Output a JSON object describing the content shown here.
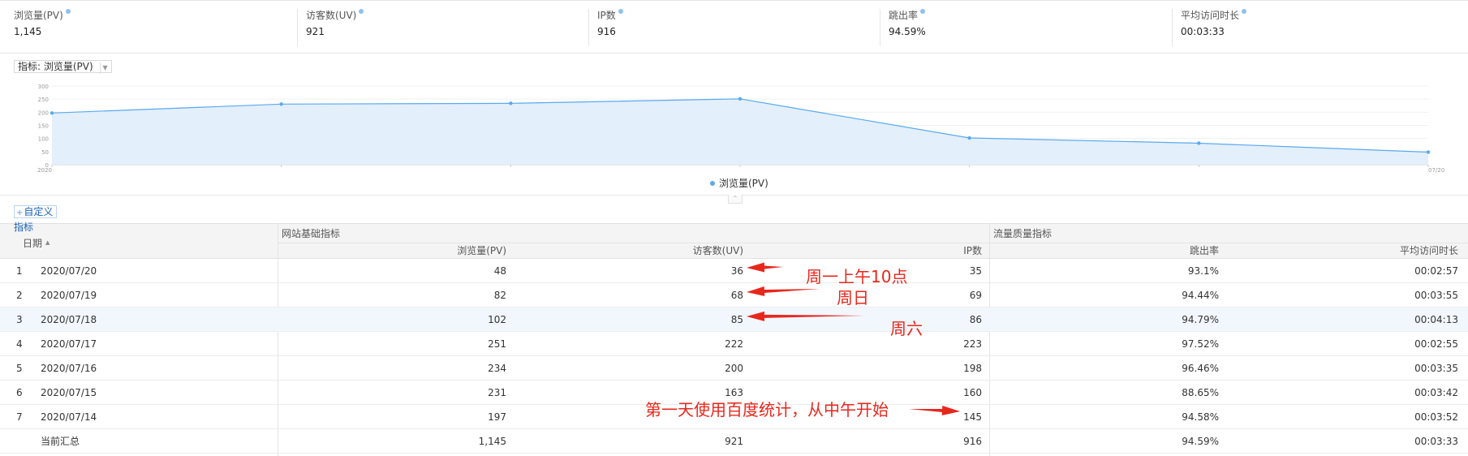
{
  "summary": [
    {
      "label": "浏览量(PV)",
      "value": "1,145"
    },
    {
      "label": "访客数(UV)",
      "value": "921"
    },
    {
      "label": "IP数",
      "value": "916"
    },
    {
      "label": "跳出率",
      "value": "94.59%"
    },
    {
      "label": "平均访问时长",
      "value": "00:03:33"
    }
  ],
  "indicator_select": {
    "prefix": "指标:",
    "value": "浏览量(PV)"
  },
  "customize_label": "自定义",
  "chart_data": {
    "type": "area",
    "x": [
      "2020/07/14",
      "2020/07/15",
      "2020/07/16",
      "2020/07/17",
      "2020/07/18",
      "2020/07/19",
      "2020/07/20"
    ],
    "x_tick_labels": [
      "2020",
      "",
      "",
      "",
      "",
      "",
      "07/20"
    ],
    "series": [
      {
        "name": "浏览量(PV)",
        "values": [
          197,
          231,
          234,
          251,
          102,
          82,
          48
        ],
        "color": "#5aa9ef"
      }
    ],
    "ylim": [
      0,
      300
    ],
    "yticks": [
      0,
      50,
      100,
      150,
      200,
      250,
      300
    ],
    "fill_color": "#e3effb",
    "grid": true,
    "legend": "bottom-center"
  },
  "table": {
    "corner_top": "指标",
    "corner_bottom": "日期",
    "group_basic": "网站基础指标",
    "group_quality": "流量质量指标",
    "columns": [
      "浏览量(PV)",
      "访客数(UV)",
      "IP数",
      "跳出率",
      "平均访问时长"
    ],
    "rows": [
      {
        "idx": "1",
        "date": "2020/07/20",
        "pv": "48",
        "uv": "36",
        "ip": "35",
        "bounce": "93.1%",
        "dur": "00:02:57"
      },
      {
        "idx": "2",
        "date": "2020/07/19",
        "pv": "82",
        "uv": "68",
        "ip": "69",
        "bounce": "94.44%",
        "dur": "00:03:55"
      },
      {
        "idx": "3",
        "date": "2020/07/18",
        "pv": "102",
        "uv": "85",
        "ip": "86",
        "bounce": "94.79%",
        "dur": "00:04:13"
      },
      {
        "idx": "4",
        "date": "2020/07/17",
        "pv": "251",
        "uv": "222",
        "ip": "223",
        "bounce": "97.52%",
        "dur": "00:02:55"
      },
      {
        "idx": "5",
        "date": "2020/07/16",
        "pv": "234",
        "uv": "200",
        "ip": "198",
        "bounce": "96.46%",
        "dur": "00:03:35"
      },
      {
        "idx": "6",
        "date": "2020/07/15",
        "pv": "231",
        "uv": "163",
        "ip": "160",
        "bounce": "88.65%",
        "dur": "00:03:42"
      },
      {
        "idx": "7",
        "date": "2020/07/14",
        "pv": "197",
        "uv": "",
        "ip": "145",
        "bounce": "94.58%",
        "dur": "00:03:52"
      }
    ],
    "total": {
      "label": "当前汇总",
      "pv": "1,145",
      "uv": "921",
      "ip": "916",
      "bounce": "94.59%",
      "dur": "00:03:33"
    }
  },
  "annotations": {
    "note_monday": "周一上午10点",
    "note_sunday": "周日",
    "note_saturday": "周六",
    "note_first_day": "第一天使用百度统计，从中午开始",
    "color": "#e8271c"
  }
}
